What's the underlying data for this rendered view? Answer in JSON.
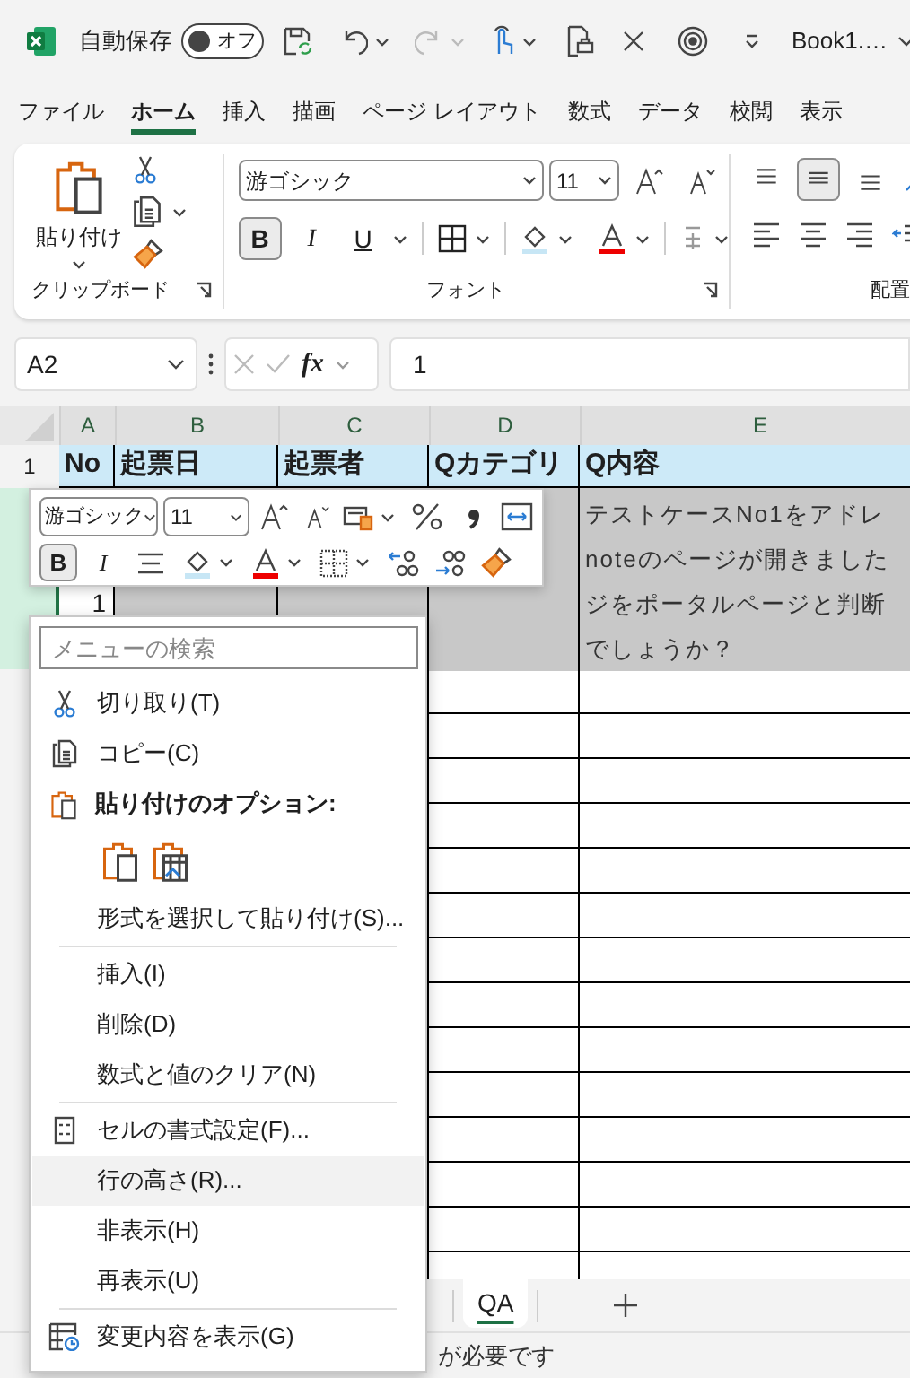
{
  "title_bar": {
    "autosave_label": "自動保存",
    "autosave_toggle": {
      "label": "オフ",
      "on": false
    },
    "document_title": "Book1.…"
  },
  "ribbon_tabs": [
    {
      "label": "ファイル",
      "selected": false
    },
    {
      "label": "ホーム",
      "selected": true
    },
    {
      "label": "挿入",
      "selected": false
    },
    {
      "label": "描画",
      "selected": false
    },
    {
      "label": "ページ レイアウト",
      "selected": false
    },
    {
      "label": "数式",
      "selected": false
    },
    {
      "label": "データ",
      "selected": false
    },
    {
      "label": "校閲",
      "selected": false
    },
    {
      "label": "表示",
      "selected": false
    }
  ],
  "ribbon": {
    "paste_label": "貼り付け",
    "font_name": "游ゴシック",
    "font_size": "11",
    "style_buttons": [
      {
        "label": "B",
        "pressed": true
      },
      {
        "label": "I",
        "pressed": false
      },
      {
        "label": "U",
        "pressed": false
      }
    ],
    "vertical_align_buttons": [
      {
        "pressed": false
      },
      {
        "pressed": true
      },
      {
        "pressed": false
      }
    ],
    "groups": [
      {
        "label": "クリップボード"
      },
      {
        "label": "フォント"
      },
      {
        "label": "配置"
      }
    ]
  },
  "formula_bar": {
    "name_box": "A2",
    "function_label": "fx",
    "value": "1"
  },
  "sheet": {
    "columns": [
      "A",
      "B",
      "C",
      "D",
      "E"
    ],
    "header_row": {
      "number": "1",
      "cells": [
        "No",
        "起票日",
        "起票者",
        "Qカテゴリ",
        "Q内容"
      ]
    },
    "selected_row": {
      "selected": true,
      "no": "1",
      "content_lines": [
        "テストケースNo1をアドレ",
        "noteのページが開きました",
        "ジをポータルページと判断",
        "でしょうか？"
      ]
    }
  },
  "mini_toolbar": {
    "font_name": "游ゴシック",
    "font_size": "11",
    "style_buttons": [
      {
        "label": "B",
        "pressed": true
      },
      {
        "label": "I",
        "pressed": false
      }
    ]
  },
  "context_menu": {
    "search_placeholder": "メニューの検索",
    "items": [
      {
        "kind": "command",
        "label": "切り取り(T)",
        "highlighted": false
      },
      {
        "kind": "command",
        "label": "コピー(C)",
        "highlighted": false
      },
      {
        "kind": "heading",
        "label": "貼り付けのオプション:"
      },
      {
        "kind": "paste_options"
      },
      {
        "kind": "command",
        "label": "形式を選択して貼り付け(S)...",
        "highlighted": false
      },
      {
        "kind": "separator"
      },
      {
        "kind": "command",
        "label": "挿入(I)",
        "highlighted": false
      },
      {
        "kind": "command",
        "label": "削除(D)",
        "highlighted": false
      },
      {
        "kind": "command",
        "label": "数式と値のクリア(N)",
        "highlighted": false
      },
      {
        "kind": "separator"
      },
      {
        "kind": "command",
        "label": "セルの書式設定(F)...",
        "highlighted": false
      },
      {
        "kind": "command",
        "label": "行の高さ(R)...",
        "highlighted": true
      },
      {
        "kind": "command",
        "label": "非表示(H)",
        "highlighted": false
      },
      {
        "kind": "command",
        "label": "再表示(U)",
        "highlighted": false
      },
      {
        "kind": "separator"
      },
      {
        "kind": "command",
        "label": "変更内容を表示(G)",
        "highlighted": false
      }
    ]
  },
  "sheet_tabs": [
    {
      "label": "QA",
      "selected": true
    }
  ],
  "status_bar": {
    "text": "が必要です"
  }
}
